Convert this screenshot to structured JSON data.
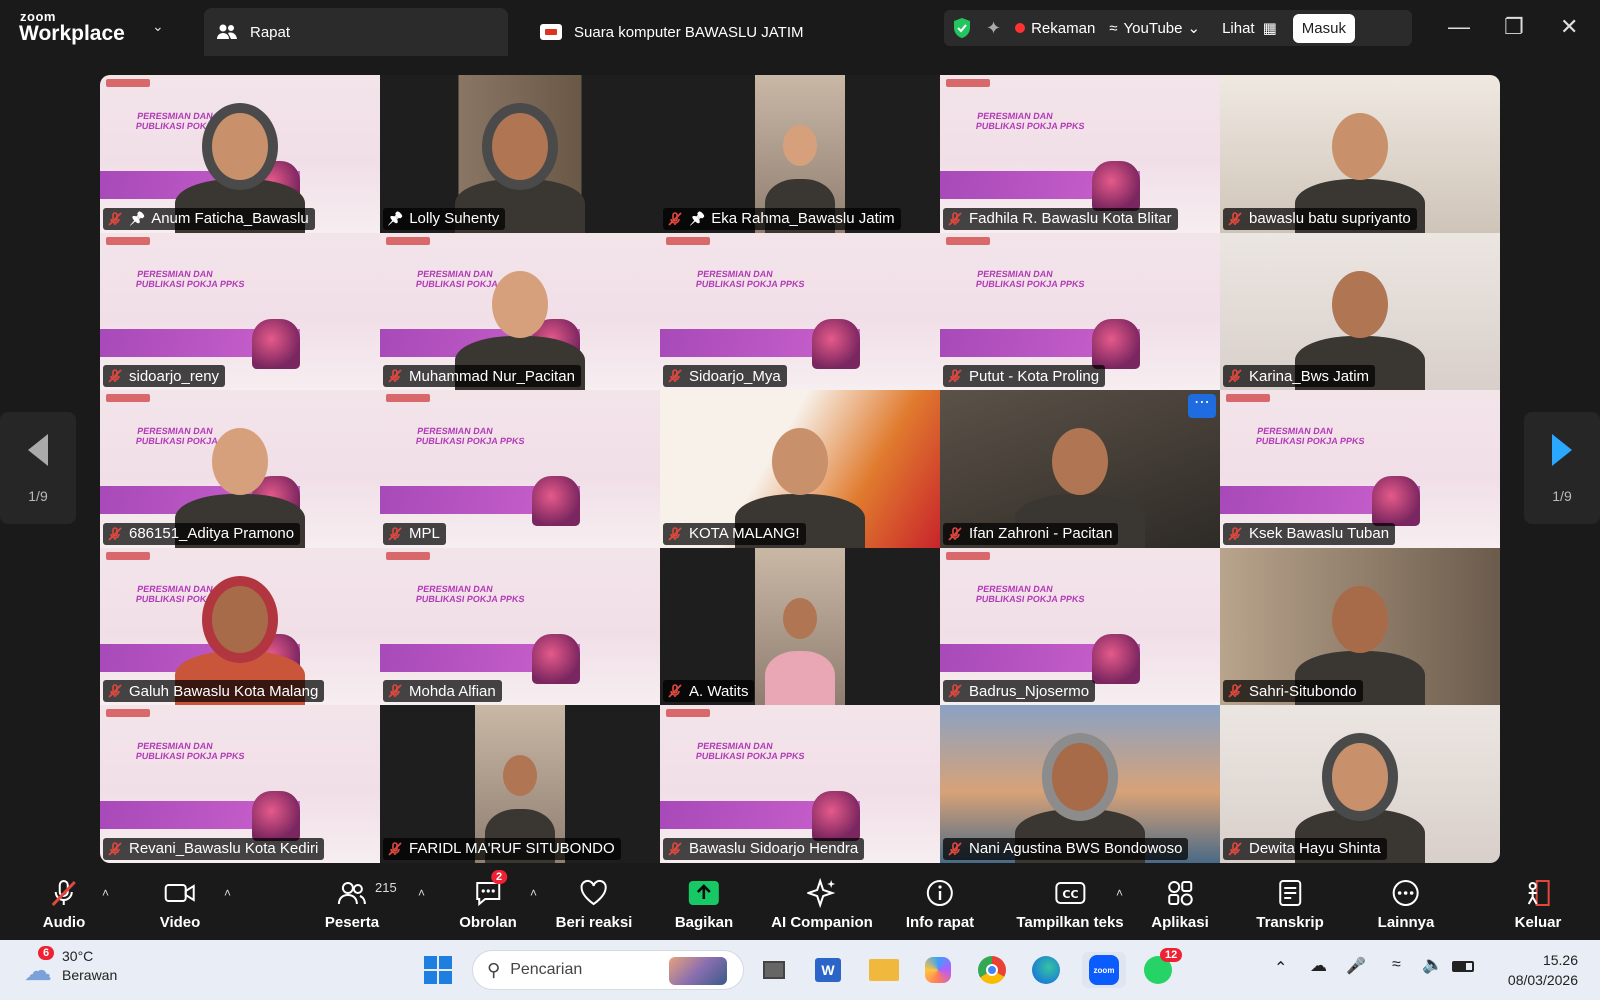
{
  "app": {
    "brand_small": "zoom",
    "brand_big": "Workplace"
  },
  "tabs": [
    {
      "label": "Rapat",
      "icon": "people-icon"
    },
    {
      "label": "Suara komputer BAWASLU JATIM",
      "icon": "device-icon"
    }
  ],
  "toolbar": {
    "recording": "Rekaman",
    "stream": "YouTube",
    "view": "Lihat",
    "signin": "Masuk"
  },
  "pager": {
    "left": "1/9",
    "right": "1/9"
  },
  "slide": {
    "title": "PERESMIAN DAN PUBLIKASI POKJA PPKS"
  },
  "participants": [
    {
      "name": "Anum Faticha_Bawaslu",
      "kind": "slide",
      "pinned": true,
      "person": "hijab-glasses"
    },
    {
      "name": "Lolly Suhenty",
      "kind": "cam",
      "pinned": true,
      "highlight": true,
      "person": "hijab"
    },
    {
      "name": "Eka Rahma_Bawaslu Jatim",
      "kind": "narrow",
      "pinned": true,
      "person": "short-hair"
    },
    {
      "name": "Fadhila R. Bawaslu Kota Blitar",
      "kind": "slide"
    },
    {
      "name": "bawaslu batu supriyanto",
      "kind": "cam",
      "person": "man-room"
    },
    {
      "name": "sidoarjo_reny",
      "kind": "slide"
    },
    {
      "name": "Muhammad Nur_Pacitan",
      "kind": "slide",
      "person": "man-dark"
    },
    {
      "name": "Sidoarjo_Mya",
      "kind": "slide"
    },
    {
      "name": "Putut - Kota Proling",
      "kind": "slide"
    },
    {
      "name": "Karina_Bws Jatim",
      "kind": "cam",
      "person": "woman"
    },
    {
      "name": "686151_Aditya Pramono",
      "kind": "slide",
      "person": "man-glasses"
    },
    {
      "name": "MPL",
      "kind": "slide"
    },
    {
      "name": "KOTA MALANG!",
      "kind": "cam",
      "person": "man-batik"
    },
    {
      "name": "Ifan Zahroni - Pacitan",
      "kind": "cam",
      "person": "man-shirt",
      "more": true
    },
    {
      "name": "Ksek Bawaslu Tuban",
      "kind": "slide"
    },
    {
      "name": "Galuh Bawaslu Kota Malang",
      "kind": "slide",
      "person": "avatar-hijab"
    },
    {
      "name": "Mohda Alfian",
      "kind": "slide"
    },
    {
      "name": "A. Watits",
      "kind": "narrow",
      "person": "man-pink"
    },
    {
      "name": "Badrus_Njosermo",
      "kind": "slide"
    },
    {
      "name": "Sahri-Situbondo",
      "kind": "cam",
      "person": "man-cap"
    },
    {
      "name": "Revani_Bawaslu Kota Kediri",
      "kind": "slide"
    },
    {
      "name": "FARIDL MA'RUF SITUBONDO",
      "kind": "narrow",
      "person": "man-jacket"
    },
    {
      "name": "Bawaslu Sidoarjo Hendra",
      "kind": "slide"
    },
    {
      "name": "Nani Agustina BWS Bondowoso",
      "kind": "cam",
      "person": "hijab-bridge"
    },
    {
      "name": "Dewita Hayu Shinta",
      "kind": "cam",
      "person": "hijab-glasses2"
    }
  ],
  "controls": [
    {
      "label": "Audio",
      "icon": "mic-off-icon"
    },
    {
      "label": "Video",
      "icon": "video-icon"
    },
    {
      "label": "Peserta",
      "icon": "participants-icon",
      "count": "215"
    },
    {
      "label": "Obrolan",
      "icon": "chat-icon",
      "badge": "2"
    },
    {
      "label": "Beri reaksi",
      "icon": "heart-icon"
    },
    {
      "label": "Bagikan",
      "icon": "share-icon"
    },
    {
      "label": "AI Companion",
      "icon": "sparkle-icon"
    },
    {
      "label": "Info rapat",
      "icon": "info-icon"
    },
    {
      "label": "Tampilkan teks",
      "icon": "cc-icon"
    },
    {
      "label": "Aplikasi",
      "icon": "apps-icon"
    },
    {
      "label": "Transkrip",
      "icon": "transcript-icon"
    },
    {
      "label": "Lainnya",
      "icon": "more-icon"
    },
    {
      "label": "Keluar",
      "icon": "leave-icon"
    }
  ],
  "taskbar": {
    "weather_temp": "30°C",
    "weather_desc": "Berawan",
    "weather_badge": "6",
    "search_placeholder": "Pencarian",
    "whatsapp_badge": "12",
    "time": "15.26",
    "date": "08/03/2026"
  },
  "colors": {
    "accent_green": "#2bd66e",
    "muted_red": "#e0483e",
    "zoom_blue": "#0b5cff"
  }
}
